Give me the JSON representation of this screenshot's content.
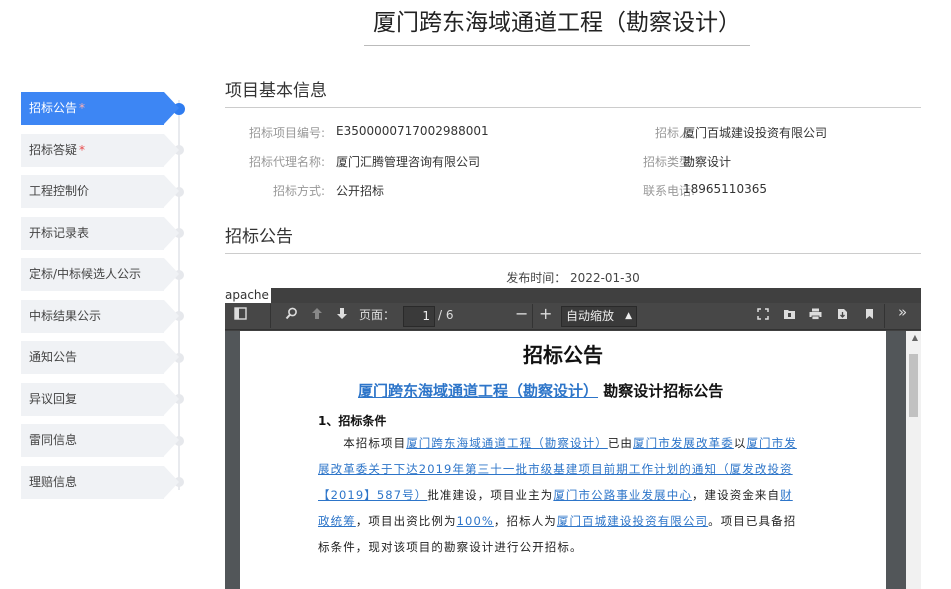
{
  "page_title": "厦门跨东海域通道工程（勘察设计）",
  "sidebar": {
    "items": [
      {
        "label": "招标公告",
        "required": "*"
      },
      {
        "label": "招标答疑",
        "required": "*"
      },
      {
        "label": "工程控制价",
        "required": ""
      },
      {
        "label": "开标记录表",
        "required": ""
      },
      {
        "label": "定标/中标候选人公示",
        "required": ""
      },
      {
        "label": "中标结果公示",
        "required": ""
      },
      {
        "label": "通知公告",
        "required": ""
      },
      {
        "label": "异议回复",
        "required": ""
      },
      {
        "label": "雷同信息",
        "required": ""
      },
      {
        "label": "理赔信息",
        "required": ""
      }
    ]
  },
  "basic_info": {
    "title": "项目基本信息",
    "project_no_label": "招标项目编号:",
    "project_no": "E3500000717002988001",
    "tenderer_label": "招标人:",
    "tenderer": "厦门百城建设投资有限公司",
    "agency_label": "招标代理名称:",
    "agency": "厦门汇腾管理咨询有限公司",
    "type_label": "招标类型:",
    "type": "勘察设计",
    "method_label": "招标方式:",
    "method": "公开招标",
    "phone_label": "联系电话:",
    "phone": "18965110365"
  },
  "notice": {
    "title": "招标公告",
    "publish_time": "发布时间： 2022-01-30"
  },
  "viewer": {
    "apache_label": "apache",
    "page_label": "页面：",
    "page_current": "1",
    "page_total": "/ 6",
    "zoom": "自动缩放",
    "icons": [
      "sidebar-toggle-icon",
      "search-icon",
      "prev-page-icon",
      "next-page-icon",
      "zoom-out-icon",
      "zoom-in-icon",
      "presentation-icon",
      "open-file-icon",
      "print-icon",
      "download-icon",
      "bookmark-icon",
      "more-tools-icon"
    ]
  },
  "document": {
    "title": "招标公告",
    "subtitle_link": "厦门跨东海域通道工程（勘察设计）",
    "subtitle_rest": "勘察设计招标公告",
    "heading": "1、招标条件",
    "p1": "本招标项目",
    "p1_link": "厦门跨东海域通道工程（勘察设计）",
    "p2": "已由",
    "p2_link": "厦门市发展改革委",
    "p3": "以",
    "p3_link": "厦门市发展改革委关于下达2019年第三十一批市级基建项目前期工作计划的通知（厦发改投资【2019】587号）",
    "p4": "批准建设，项目业主为",
    "p4_link": "厦门市公路事业发展中心",
    "p5": "，建设资金来自",
    "p5_link": "财政统筹",
    "p6": "，项目出资比例为",
    "p6_link": "100%",
    "p7": "，招标人为",
    "p7_link": "厦门百城建设投资有限公司",
    "p8": "。项目已具备招标条件，现对该项目的勘察设计进行公开招标。"
  }
}
